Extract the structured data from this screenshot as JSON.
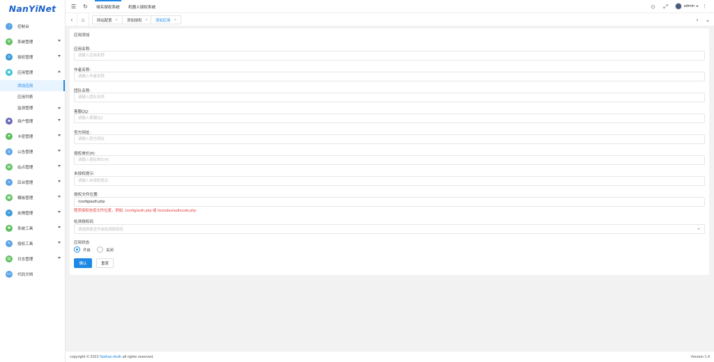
{
  "logo": {
    "text": "NanYiNet"
  },
  "sidebar": {
    "items": [
      {
        "label": "控制台",
        "icon": "dashboard-icon",
        "color": "#5aa3e6"
      },
      {
        "label": "系统管理",
        "icon": "gear-icon",
        "color": "#5fbf5f"
      },
      {
        "label": "授权管理",
        "icon": "key-icon",
        "color": "#3a9ad9"
      },
      {
        "label": "应用管理",
        "icon": "app-icon",
        "color": "#3ec1d3"
      },
      {
        "label": "用户管理",
        "icon": "user-icon",
        "color": "#6b6bb7"
      },
      {
        "label": "卡密管理",
        "icon": "card-icon",
        "color": "#5fbf5f"
      },
      {
        "label": "公告管理",
        "icon": "megaphone-icon",
        "color": "#5aa3e6"
      },
      {
        "label": "站点管理",
        "icon": "site-icon",
        "color": "#5fbf5f"
      },
      {
        "label": "后台管理",
        "icon": "server-icon",
        "color": "#5aa3e6"
      },
      {
        "label": "模板管理",
        "icon": "template-icon",
        "color": "#5fbf5f"
      },
      {
        "label": "友情管理",
        "icon": "link-icon",
        "color": "#3a9ad9"
      },
      {
        "label": "系统工具",
        "icon": "tool-icon",
        "color": "#5fbf5f"
      },
      {
        "label": "授权工具",
        "icon": "wrench-icon",
        "color": "#5aa3e6"
      },
      {
        "label": "日志管理",
        "icon": "log-icon",
        "color": "#5fbf5f"
      },
      {
        "label": "代码文档",
        "icon": "code-icon",
        "color": "#5aa3e6"
      }
    ],
    "sub_items": [
      {
        "label": "添加应用"
      },
      {
        "label": "应用列表"
      },
      {
        "label": "监测管理"
      }
    ]
  },
  "header": {
    "tabs": [
      {
        "label": "域名授权系统"
      },
      {
        "label": "机器人授权系统"
      }
    ],
    "user": "admin"
  },
  "page_tabs": [
    {
      "label": "网站配置"
    },
    {
      "label": "添加授权"
    },
    {
      "label": "添加应用"
    }
  ],
  "form": {
    "title": "应用添加",
    "fields": [
      {
        "label": "应用名称:",
        "placeholder": "请输入应用名称",
        "value": ""
      },
      {
        "label": "作者名称:",
        "placeholder": "请输入作者名称",
        "value": ""
      },
      {
        "label": "团队名称:",
        "placeholder": "请输入团队名称",
        "value": ""
      },
      {
        "label": "客服QQ:",
        "placeholder": "请输入客服QQ",
        "value": ""
      },
      {
        "label": "官方网址:",
        "placeholder": "请输入官方网址",
        "value": ""
      },
      {
        "label": "授权单价(¥):",
        "placeholder": "请输入授权单价(¥)",
        "value": ""
      },
      {
        "label": "未授权提示:",
        "placeholder": "请输入未授权提示",
        "value": ""
      },
      {
        "label": "授权文件位置:",
        "placeholder": "",
        "value": "/config/auth.php"
      }
    ],
    "hint": "程序授权信息文件位置，例如: /config/auth.php 或 /includes/authcode.php",
    "select": {
      "label": "检测授权码",
      "placeholder": "请选择是否开启检测授权码"
    },
    "status": {
      "label": "应用状态",
      "on": "开启",
      "off": "关闭",
      "selected": "开启"
    },
    "buttons": {
      "submit": "确认",
      "reset": "重置"
    }
  },
  "footer": {
    "prefix": "copyright © 2022 ",
    "brand": "Nathan-Auth",
    "suffix": " all rights reserved.",
    "version": "Version 1.4"
  },
  "colors": {
    "accent": "#1e88e5",
    "hint": "#e64040",
    "logo": "#1e62c8"
  }
}
